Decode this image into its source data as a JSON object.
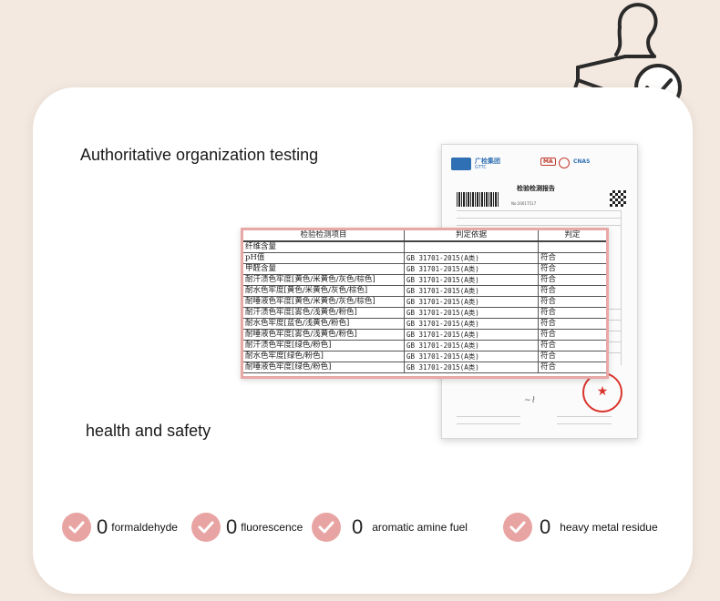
{
  "headings": {
    "authority": "Authoritative organization testing",
    "health": "health and safety"
  },
  "report": {
    "org_name": "广检集团",
    "org_abbr": "GTTC",
    "cert_mark": "MA",
    "cert_mark_2": "CNAS",
    "title": "检验检测报告",
    "report_no": "No:20017517"
  },
  "table": {
    "headers": [
      "检验检测项目",
      "判定依据",
      "判定"
    ],
    "rows": [
      [
        "纤维含量",
        "",
        ""
      ],
      [
        "pH值",
        "GB 31701-2015(A类)",
        "符合"
      ],
      [
        "甲醛含量",
        "GB 31701-2015(A类)",
        "符合"
      ],
      [
        "耐汗渍色牢度[黄色/米黄色/灰色/棕色]",
        "GB 31701-2015(A类)",
        "符合"
      ],
      [
        "耐水色牢度[黄色/米黄色/灰色/棕色]",
        "GB 31701-2015(A类)",
        "符合"
      ],
      [
        "耐唾液色牢度[黄色/米黄色/灰色/棕色]",
        "GB 31701-2015(A类)",
        "符合"
      ],
      [
        "耐汗渍色牢度[雾色/浅黄色/粉色]",
        "GB 31701-2015(A类)",
        "符合"
      ],
      [
        "耐水色牢度[蓝色/浅黄色/粉色]",
        "GB 31701-2015(A类)",
        "符合"
      ],
      [
        "耐唾液色牢度[雾色/浅黄色/粉色]",
        "GB 31701-2015(A类)",
        "符合"
      ],
      [
        "耐汗渍色牢度[绿色/粉色]",
        "GB 31701-2015(A类)",
        "符合"
      ],
      [
        "耐水色牢度[绿色/粉色]",
        "GB 31701-2015(A类)",
        "符合"
      ],
      [
        "耐唾液色牢度[绿色/粉色]",
        "GB 31701-2015(A类)",
        "符合"
      ]
    ]
  },
  "features": [
    {
      "count": "0",
      "label": "formaldehyde"
    },
    {
      "count": "0",
      "label": "fluorescence"
    },
    {
      "count": "0",
      "label": "aromatic amine fuel"
    },
    {
      "count": "0",
      "label": "heavy metal residue"
    }
  ],
  "icons": {
    "stamp": "stamp-check-icon",
    "check": "check-circle-icon",
    "seal": "red-star-seal-icon"
  },
  "colors": {
    "background": "#f3e9e1",
    "accent_pink": "#e8a4a2",
    "table_border": "#e7a8a6",
    "seal_red": "#d9342b"
  }
}
